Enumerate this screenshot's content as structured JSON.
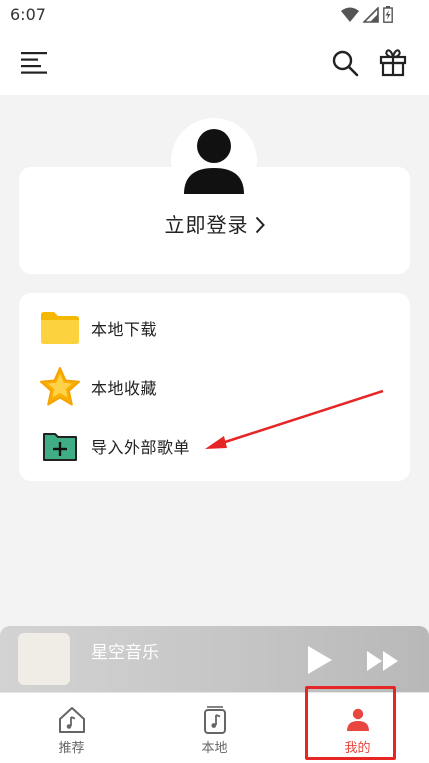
{
  "status_bar": {
    "time": "6:07",
    "icons": [
      "wifi-icon",
      "signal-icon",
      "battery-charging-icon"
    ]
  },
  "app_bar": {
    "icons": [
      "menu-icon",
      "search-icon",
      "gift-icon"
    ]
  },
  "login": {
    "label": "立即登录"
  },
  "menu": {
    "items": [
      {
        "label": "本地下载",
        "icon": "folder-icon"
      },
      {
        "label": "本地收藏",
        "icon": "star-icon"
      },
      {
        "label": "导入外部歌单",
        "icon": "folder-add-icon"
      }
    ]
  },
  "player": {
    "title": "星空音乐"
  },
  "tabs": [
    {
      "label": "推荐",
      "icon": "home-music-icon",
      "active": false
    },
    {
      "label": "本地",
      "icon": "music-file-icon",
      "active": false
    },
    {
      "label": "我的",
      "icon": "person-icon",
      "active": true
    }
  ],
  "colors": {
    "accent": "#e8463f",
    "annotation": "#e62525",
    "folder": "#fbc02d",
    "star": "#f9b000",
    "folder_add": "#3fae85"
  }
}
